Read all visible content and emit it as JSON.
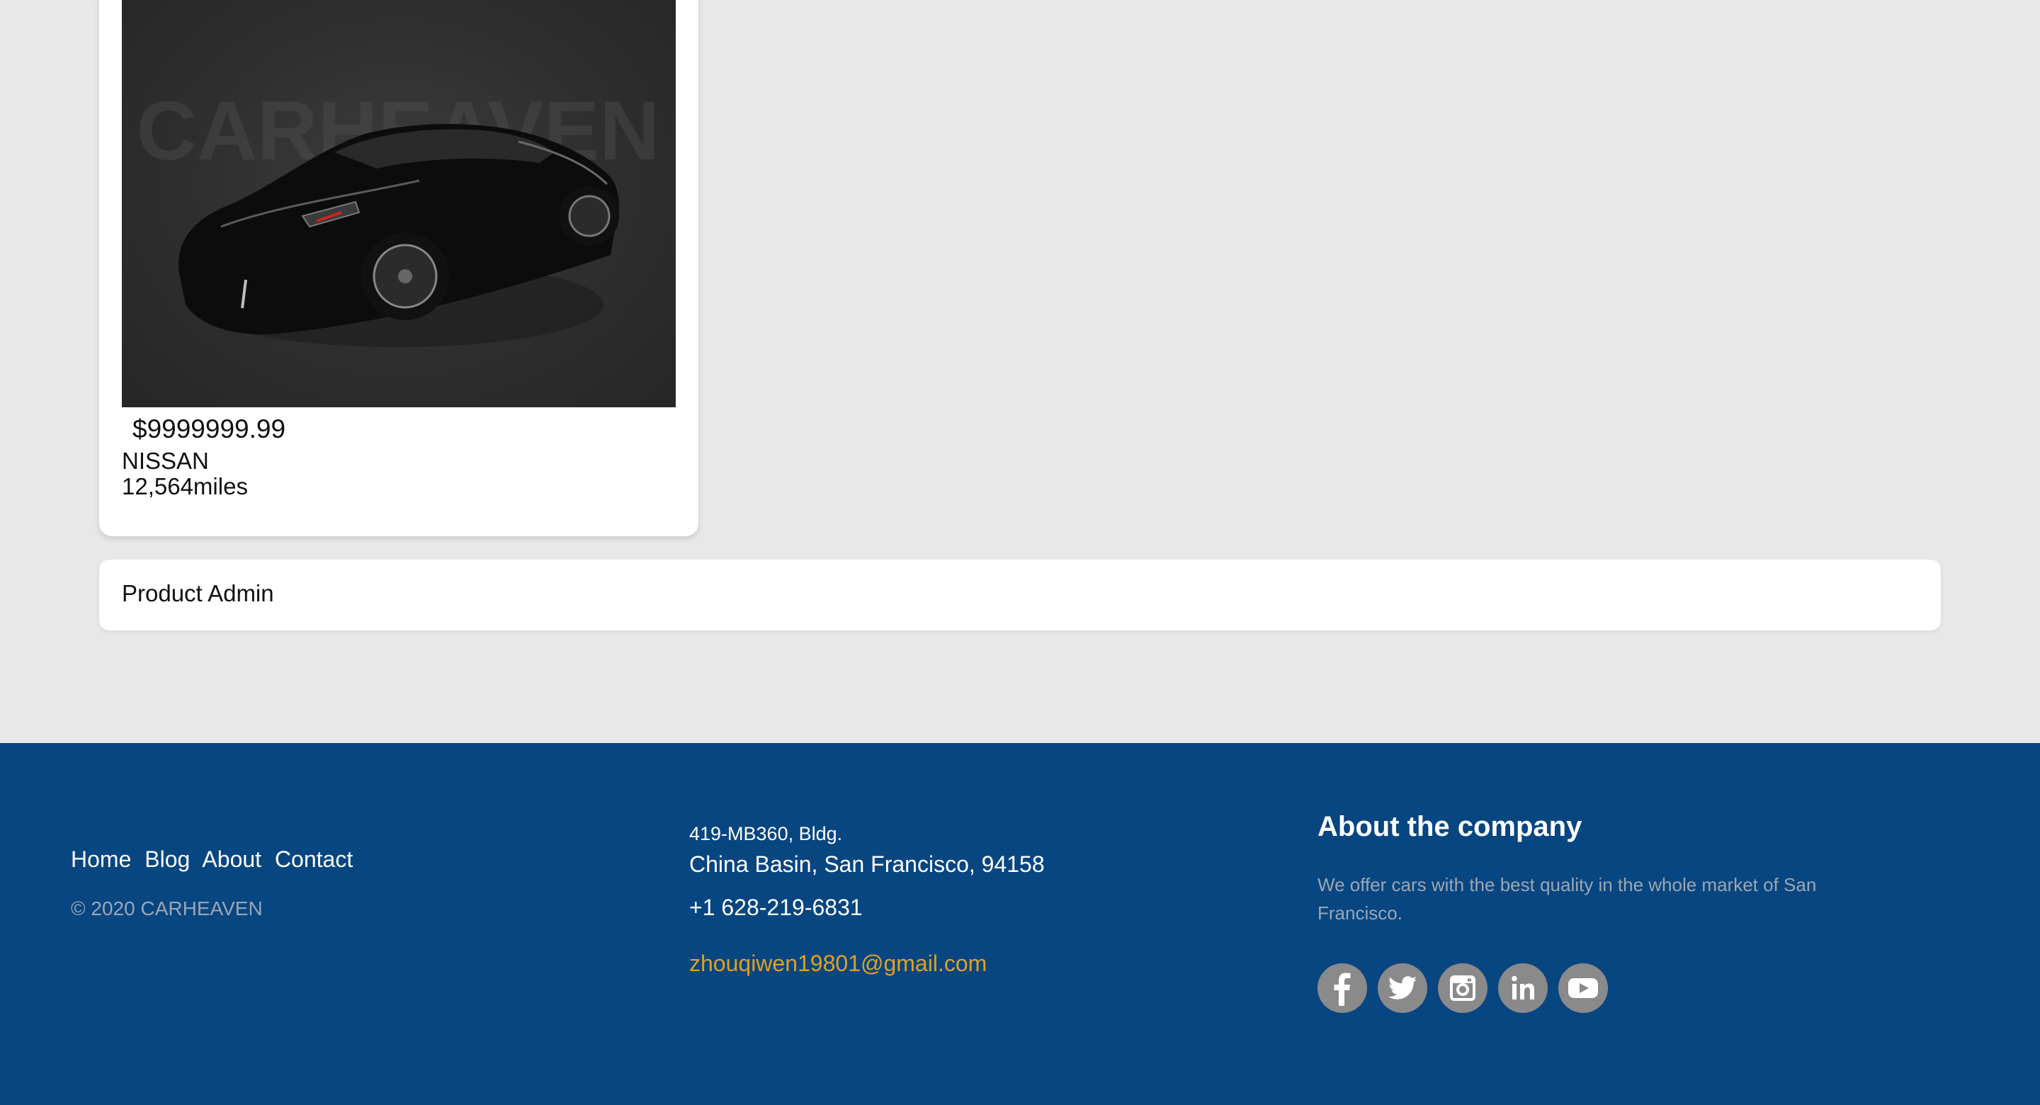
{
  "listing": {
    "watermark": "CARHEAVEN",
    "price": "$9999999.99",
    "brand": "NISSAN",
    "mileage": "12,564miles"
  },
  "admin": {
    "label": "Product Admin"
  },
  "footer": {
    "nav": {
      "home": "Home",
      "blog": "Blog",
      "about": "About",
      "contact": "Contact"
    },
    "copyright": "© 2020 CARHEAVEN",
    "address_line1": "419-MB360, Bldg.",
    "address_line2": "China Basin, San Francisco, 94158",
    "phone": "+1 628-219-6831",
    "email": "zhouqiwen19801@gmail.com",
    "about_title": "About the company",
    "about_text": "We offer cars with the best quality in the whole market of San Francisco.",
    "socials": [
      "facebook-icon",
      "twitter-icon",
      "instagram-icon",
      "linkedin-icon",
      "youtube-icon"
    ]
  },
  "colors": {
    "page_background": "#e8e8e8",
    "footer_background": "#084681",
    "email_link": "#e0a020",
    "muted_text": "#9ba6b3",
    "social_icon_bg": "#8a8a8a"
  }
}
